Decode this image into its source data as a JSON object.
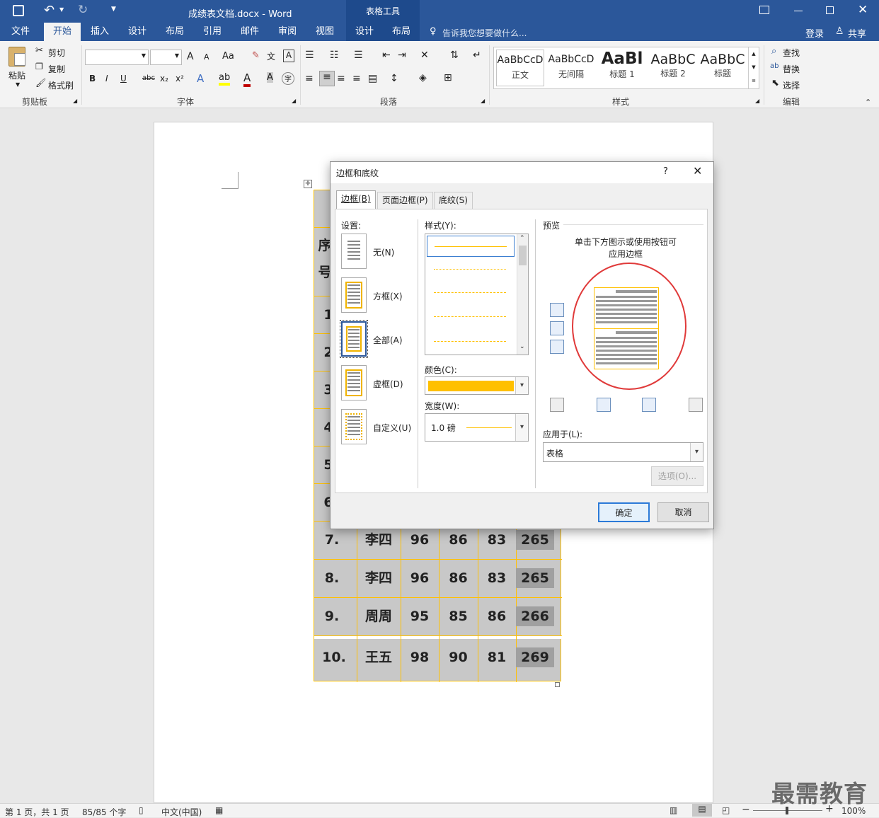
{
  "window": {
    "title": "成绩表文档.docx - Word",
    "context_tab": "表格工具"
  },
  "tabs": [
    {
      "label": "文件"
    },
    {
      "label": "开始"
    },
    {
      "label": "插入"
    },
    {
      "label": "设计"
    },
    {
      "label": "布局"
    },
    {
      "label": "引用"
    },
    {
      "label": "邮件"
    },
    {
      "label": "审阅"
    },
    {
      "label": "视图"
    },
    {
      "label": "设计"
    },
    {
      "label": "布局"
    }
  ],
  "tellme": "告诉我您想要做什么...",
  "account": {
    "login": "登录",
    "share": "共享"
  },
  "ribbon": {
    "clipboard": {
      "paste": "粘贴",
      "cut": "剪切",
      "copy": "复制",
      "format_painter": "格式刷",
      "label": "剪贴板"
    },
    "font": {
      "label": "字体",
      "bold": "B",
      "italic": "I",
      "underline": "U",
      "strike": "abc",
      "sub": "x₂",
      "sup": "x²",
      "aa": "Aa",
      "grow": "A",
      "shrink": "A"
    },
    "paragraph": {
      "label": "段落"
    },
    "styles": {
      "label": "样式",
      "items": [
        {
          "preview": "AaBbCcD",
          "name": "正文"
        },
        {
          "preview": "AaBbCcD",
          "name": "无间隔"
        },
        {
          "preview": "AaBl",
          "name": "标题 1"
        },
        {
          "preview": "AaBbC",
          "name": "标题 2"
        },
        {
          "preview": "AaBbC",
          "name": "标题"
        }
      ]
    },
    "editing": {
      "label": "编辑",
      "find": "查找",
      "replace": "替换",
      "select": "选择"
    }
  },
  "table": {
    "header_partial": [
      "序",
      "号"
    ],
    "row_numbers_partial": [
      "1",
      "2",
      "3",
      "4",
      "5",
      "6"
    ],
    "rows": [
      {
        "no": "7.",
        "name": "李四",
        "a": "96",
        "b": "86",
        "c": "83",
        "total": "265"
      },
      {
        "no": "8.",
        "name": "李四",
        "a": "96",
        "b": "86",
        "c": "83",
        "total": "265"
      },
      {
        "no": "9.",
        "name": "周周",
        "a": "95",
        "b": "85",
        "c": "86",
        "total": "266"
      },
      {
        "no": "10.",
        "name": "王五",
        "a": "98",
        "b": "90",
        "c": "81",
        "total": "269"
      }
    ]
  },
  "dialog": {
    "title": "边框和底纹",
    "help": "?",
    "tabs": [
      {
        "label": "边框(B)"
      },
      {
        "label": "页面边框(P)"
      },
      {
        "label": "底纹(S)"
      }
    ],
    "settings_label": "设置:",
    "settings": [
      {
        "label": "无(N)"
      },
      {
        "label": "方框(X)"
      },
      {
        "label": "全部(A)"
      },
      {
        "label": "虚框(D)"
      },
      {
        "label": "自定义(U)"
      }
    ],
    "style_label": "样式(Y):",
    "color_label": "颜色(C):",
    "color_value": "#ffc000",
    "width_label": "宽度(W):",
    "width_value": "1.0 磅",
    "preview_label": "预览",
    "preview_hint": "单击下方图示或使用按钮可应用边框",
    "apply_label": "应用于(L):",
    "apply_value": "表格",
    "options": "选项(O)...",
    "ok": "确定",
    "cancel": "取消"
  },
  "status": {
    "page": "第 1 页，共 1 页",
    "words": "85/85 个字",
    "lang": "中文(中国)",
    "zoom": "100%"
  },
  "watermark": "最需教育",
  "colors": {
    "brand": "#2b579a",
    "border_accent": "#ffc000",
    "circle": "#e03a3a"
  }
}
